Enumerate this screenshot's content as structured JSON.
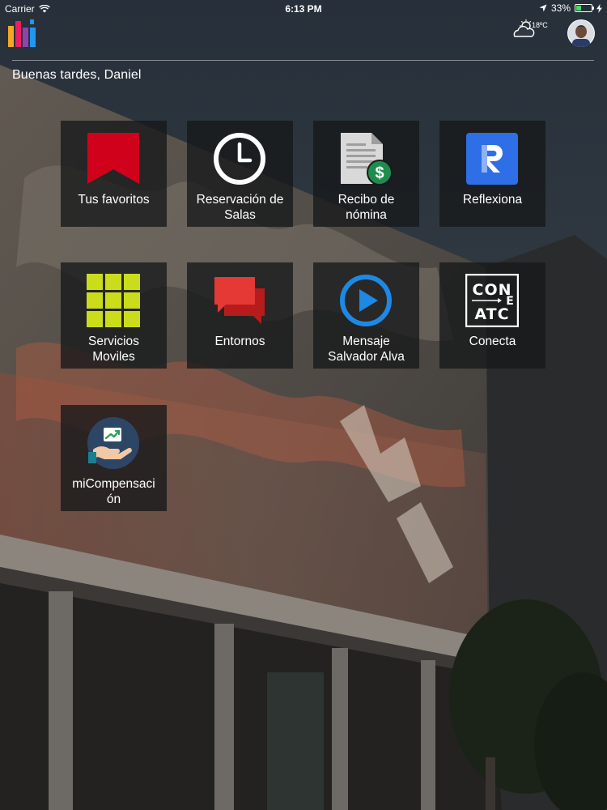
{
  "status_bar": {
    "carrier": "Carrier",
    "time": "6:13 PM",
    "battery": "33%",
    "battery_level": 0.33
  },
  "header": {
    "logo_icon": "app-logo-icon",
    "weather_icon": "partly-cloudy-icon",
    "temperature": "18ºC",
    "avatar_icon": "user-avatar-icon"
  },
  "greeting": "Buenas tardes, Daniel",
  "tiles": [
    {
      "label_lines": [
        "Tus favoritos"
      ],
      "icon": "bookmark-icon",
      "color": "#d0021b"
    },
    {
      "label_lines": [
        "Reservación de",
        "Salas"
      ],
      "icon": "clock-icon",
      "color": "#ffffff"
    },
    {
      "label_lines": [
        "Recibo de",
        "nómina"
      ],
      "icon": "payroll-document-icon",
      "color": "#1e8c4e"
    },
    {
      "label_lines": [
        "Reflexiona"
      ],
      "icon": "reflexiona-r-icon",
      "color": "#2e6ee6"
    },
    {
      "label_lines": [
        "Servicios",
        "Moviles"
      ],
      "icon": "grid-apps-icon",
      "color": "#cbdc1b"
    },
    {
      "label_lines": [
        "Entornos"
      ],
      "icon": "chat-bubbles-icon",
      "color": "#e53935"
    },
    {
      "label_lines": [
        "Mensaje",
        "Salvador Alva"
      ],
      "icon": "play-circle-icon",
      "color": "#1e88e5"
    },
    {
      "label_lines": [
        "Conecta"
      ],
      "icon": "conecta-logo-icon",
      "color": "#ffffff"
    },
    {
      "label_lines": [
        "miCompensaci",
        "ón"
      ],
      "icon": "compensation-hand-icon",
      "color": "#2d4665"
    }
  ]
}
